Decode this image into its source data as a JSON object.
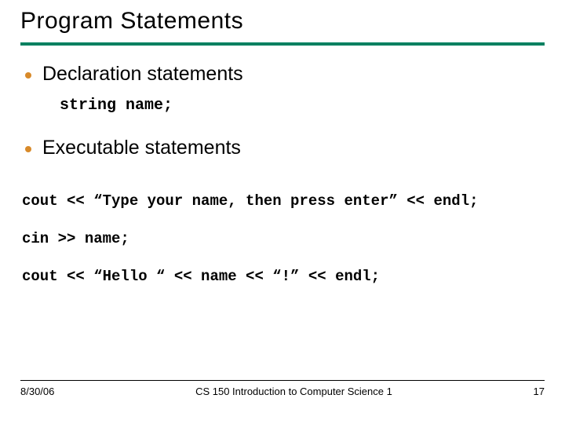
{
  "title": "Program Statements",
  "bullets": [
    {
      "text": "Declaration statements"
    },
    {
      "text": "Executable statements"
    }
  ],
  "code_indent": "string name;",
  "code_lines": [
    "cout << “Type your name, then press enter” << endl;",
    "cin >> name;",
    "cout << “Hello “ << name << “!” << endl;"
  ],
  "footer": {
    "date": "8/30/06",
    "course": "CS 150 Introduction to Computer Science 1",
    "page": "17"
  }
}
